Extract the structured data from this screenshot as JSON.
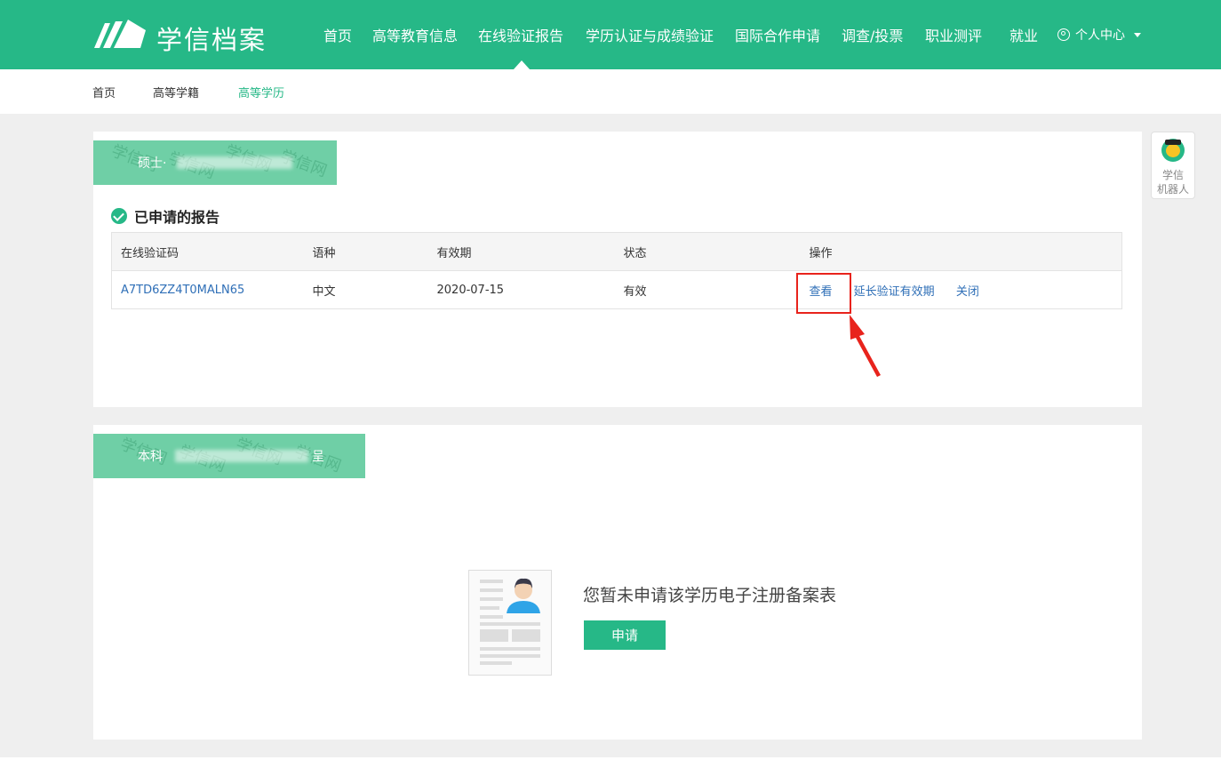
{
  "header": {
    "logo_text": "学信档案",
    "nav": [
      {
        "label": "首页"
      },
      {
        "label": "高等教育信息"
      },
      {
        "label": "在线验证报告",
        "active": true
      },
      {
        "label": "学历认证与成绩验证"
      },
      {
        "label": "国际合作申请"
      },
      {
        "label": "调查/投票"
      },
      {
        "label": "职业测评"
      },
      {
        "label": "就业"
      }
    ],
    "user_menu_label": "个人中心"
  },
  "subnav": {
    "items": [
      {
        "label": "首页"
      },
      {
        "label": "高等学籍"
      },
      {
        "label": "高等学历",
        "active": true
      }
    ]
  },
  "card1": {
    "label": "硕士·",
    "label_tail": "",
    "section_title": "已申请的报告",
    "table": {
      "headers": [
        "在线验证码",
        "语种",
        "有效期",
        "状态",
        "操作"
      ],
      "rows": [
        {
          "code": "A7TD6ZZ4T0MALN65",
          "language": "中文",
          "valid_until": "2020-07-15",
          "status": "有效",
          "actions": [
            "查看",
            "延长验证有效期",
            "关闭"
          ]
        }
      ]
    }
  },
  "card2": {
    "label": "本科",
    "label_tail": "呈",
    "empty_text": "您暂未申请该学历电子注册备案表",
    "apply_label": "申请"
  },
  "robot": {
    "line1": "学信",
    "line2": "机器人"
  },
  "watermark_text": "学信网",
  "colors": {
    "brand": "#26b887",
    "label_bg": "#6fcfa6",
    "link": "#2f6fb7",
    "annotation": "#e8231c"
  }
}
